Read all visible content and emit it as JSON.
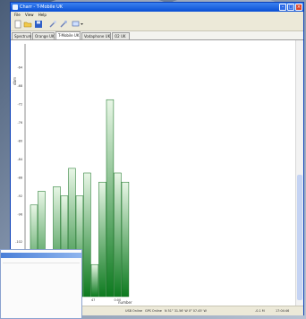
{
  "window": {
    "title": "Charr - T-Mobile UK"
  },
  "menu": [
    "File",
    "View",
    "Help"
  ],
  "toolbar": [
    "new-icon",
    "open-icon",
    "save-icon",
    "tools-icon",
    "wrench-icon",
    "monitor-dropdown-icon"
  ],
  "tabs": [
    {
      "label": "Spectrum",
      "active": false
    },
    {
      "label": "Orange UK",
      "active": false
    },
    {
      "label": "T-Mobile UK",
      "active": true
    },
    {
      "label": "Vodaphone UK",
      "active": false
    },
    {
      "label": "O2 UK",
      "active": false
    }
  ],
  "colors": {
    "bar_dark": "#0d7a1f",
    "bar_light": "#e8f6e6",
    "title_bar": "#0a4fd4"
  },
  "chart_data": {
    "type": "bar",
    "ylabel": "dbm",
    "xlabel": "number",
    "ylim": [
      -114,
      -60
    ],
    "yticks": [
      -64,
      -68,
      -72,
      -76,
      -80,
      -84,
      -88,
      -92,
      -96,
      -102,
      -108
    ],
    "xticks": [
      "20",
      "47",
      "0:00"
    ],
    "series": [
      {
        "values": [
          -94,
          -91,
          -112,
          -90,
          -92,
          -86,
          -92,
          -87,
          -107,
          -89,
          -71,
          -87,
          -89
        ]
      }
    ]
  },
  "statusbar": {
    "left": "",
    "item1": "USB Online",
    "item2": "GPS Online",
    "item3": "N 51° 31.56' W 0° 07.45' W",
    "item4": "-0.1 M",
    "item5": "17:04:46"
  }
}
